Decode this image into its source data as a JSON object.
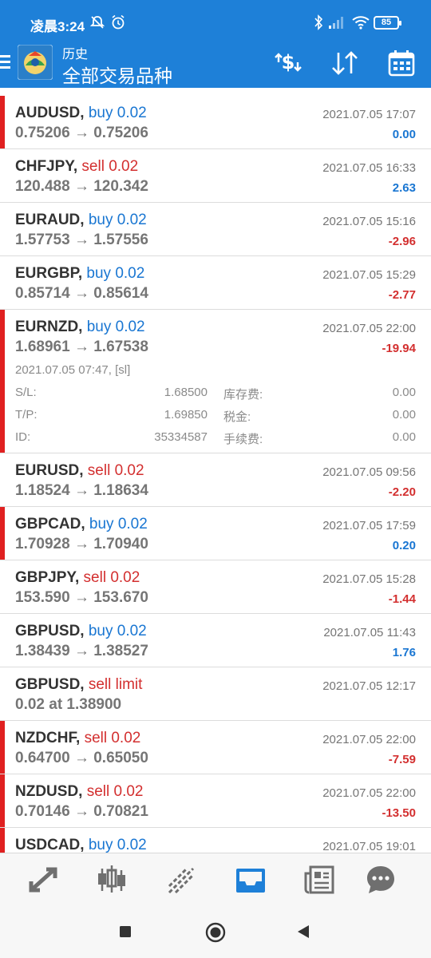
{
  "status_bar": {
    "time": "凌晨3:24",
    "battery": "85"
  },
  "app_bar": {
    "subtitle": "历史",
    "title": "全部交易品种"
  },
  "colors": {
    "primary": "#1e80d8",
    "buy": "#1976d2",
    "sell": "#d32f2f",
    "marker": "#e02020"
  },
  "trades": [
    {
      "symbol": "AUDUSD,",
      "side": "buy 0.02",
      "side_type": "buy",
      "price": "0.75206 → 0.75206",
      "datetime": "2021.07.05 17:07",
      "profit": "0.00",
      "profit_sign": "pos",
      "marked": true
    },
    {
      "symbol": "CHFJPY,",
      "side": "sell 0.02",
      "side_type": "sell",
      "price": "120.488 → 120.342",
      "datetime": "2021.07.05 16:33",
      "profit": "2.63",
      "profit_sign": "pos",
      "marked": false
    },
    {
      "symbol": "EURAUD,",
      "side": "buy 0.02",
      "side_type": "buy",
      "price": "1.57753 → 1.57556",
      "datetime": "2021.07.05 15:16",
      "profit": "-2.96",
      "profit_sign": "neg",
      "marked": false
    },
    {
      "symbol": "EURGBP,",
      "side": "buy 0.02",
      "side_type": "buy",
      "price": "0.85714 → 0.85614",
      "datetime": "2021.07.05 15:29",
      "profit": "-2.77",
      "profit_sign": "neg",
      "marked": false
    },
    {
      "symbol": "EURNZD,",
      "side": "buy 0.02",
      "side_type": "buy",
      "price": "1.68961 → 1.67538",
      "datetime": "2021.07.05 22:00",
      "profit": "-19.94",
      "profit_sign": "neg",
      "marked": true,
      "details": {
        "open": "2021.07.05 07:47, [sl]",
        "sl_label": "S/L:",
        "sl": "1.68500",
        "tp_label": "T/P:",
        "tp": "1.69850",
        "id_label": "ID:",
        "id": "35334587",
        "swap_label": "库存费:",
        "swap": "0.00",
        "tax_label": "税金:",
        "tax": "0.00",
        "fee_label": "手续费:",
        "fee": "0.00"
      }
    },
    {
      "symbol": "EURUSD,",
      "side": "sell 0.02",
      "side_type": "sell",
      "price": "1.18524 → 1.18634",
      "datetime": "2021.07.05 09:56",
      "profit": "-2.20",
      "profit_sign": "neg",
      "marked": false
    },
    {
      "symbol": "GBPCAD,",
      "side": "buy 0.02",
      "side_type": "buy",
      "price": "1.70928 → 1.70940",
      "datetime": "2021.07.05 17:59",
      "profit": "0.20",
      "profit_sign": "pos",
      "marked": true
    },
    {
      "symbol": "GBPJPY,",
      "side": "sell 0.02",
      "side_type": "sell",
      "price": "153.590 → 153.670",
      "datetime": "2021.07.05 15:28",
      "profit": "-1.44",
      "profit_sign": "neg",
      "marked": false
    },
    {
      "symbol": "GBPUSD,",
      "side": "buy 0.02",
      "side_type": "buy",
      "price": "1.38439 → 1.38527",
      "datetime": "2021.07.05 11:43",
      "profit": "1.76",
      "profit_sign": "pos",
      "marked": false
    },
    {
      "symbol": "GBPUSD,",
      "side": "sell limit",
      "side_type": "sell",
      "price": "0.02 at 1.38900",
      "datetime": "2021.07.05 12:17",
      "profit": "",
      "profit_sign": "pos",
      "marked": false
    },
    {
      "symbol": "NZDCHF,",
      "side": "sell 0.02",
      "side_type": "sell",
      "price": "0.64700 → 0.65050",
      "datetime": "2021.07.05 22:00",
      "profit": "-7.59",
      "profit_sign": "neg",
      "marked": true
    },
    {
      "symbol": "NZDUSD,",
      "side": "sell 0.02",
      "side_type": "sell",
      "price": "0.70146 → 0.70821",
      "datetime": "2021.07.05 22:00",
      "profit": "-13.50",
      "profit_sign": "neg",
      "marked": true
    },
    {
      "symbol": "USDCAD,",
      "side": "buy 0.02",
      "side_type": "buy",
      "price": "",
      "datetime": "2021.07.05 19:01",
      "profit": "",
      "profit_sign": "pos",
      "marked": true
    }
  ],
  "bottom_nav": [
    {
      "icon": "quotes-icon",
      "active": false
    },
    {
      "icon": "chart-candles-icon",
      "active": false
    },
    {
      "icon": "trade-icon",
      "active": false
    },
    {
      "icon": "history-inbox-icon",
      "active": true
    },
    {
      "icon": "news-icon",
      "active": false
    },
    {
      "icon": "chat-icon",
      "active": false
    }
  ]
}
